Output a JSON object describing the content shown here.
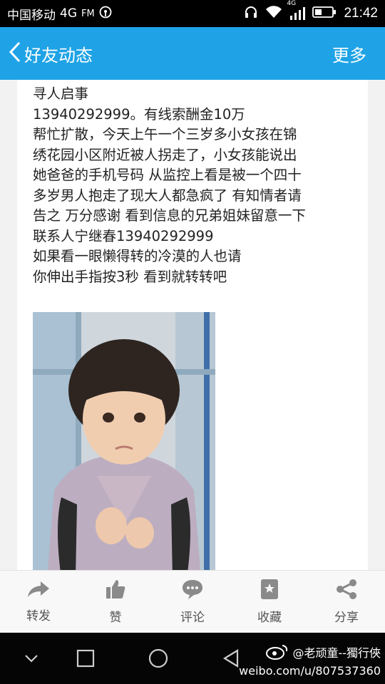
{
  "status_bar": {
    "carrier": "中国移动",
    "network": "4G",
    "fm": "FM",
    "data_label": "4G",
    "time": "21:42",
    "icons": [
      "hotspot-icon",
      "headphone-icon",
      "wifi-icon",
      "signal-icon",
      "battery-icon"
    ]
  },
  "header": {
    "back_label": "好友动态",
    "more_label": "更多",
    "color": "#1fa3e6"
  },
  "post": {
    "lines": [
      "寻人启事",
      "13940292999。有线索酬金10万",
      "帮忙扩散，今天上午一个三岁多小女孩在锦",
      "绣花园小区附近被人拐走了，小女孩能说出",
      "她爸爸的手机号码 从监控上看是被一个四十",
      "多岁男人抱走了现大人都急疯了 有知情者请",
      "告之 万分感谢 看到信息的兄弟姐妹留意一下",
      "联系人宁继春13940292999",
      "如果看一眼懒得转的冷漠的人也请",
      "你伸出手指按3秒 看到就转转吧"
    ],
    "photo_icon": "child-photo"
  },
  "actions": [
    {
      "label": "转发",
      "icon": "share-arrow-icon"
    },
    {
      "label": "赞",
      "icon": "thumbs-up-icon"
    },
    {
      "label": "评论",
      "icon": "comment-icon"
    },
    {
      "label": "收藏",
      "icon": "bookmark-icon"
    },
    {
      "label": "分享",
      "icon": "share-nodes-icon"
    }
  ],
  "nav": {
    "icons": [
      "collapse-icon",
      "recent-apps-icon",
      "home-icon",
      "back-icon"
    ],
    "watermark_name": "@老顽童--獨行俠",
    "watermark_url": "weibo.com/u/807537360"
  }
}
